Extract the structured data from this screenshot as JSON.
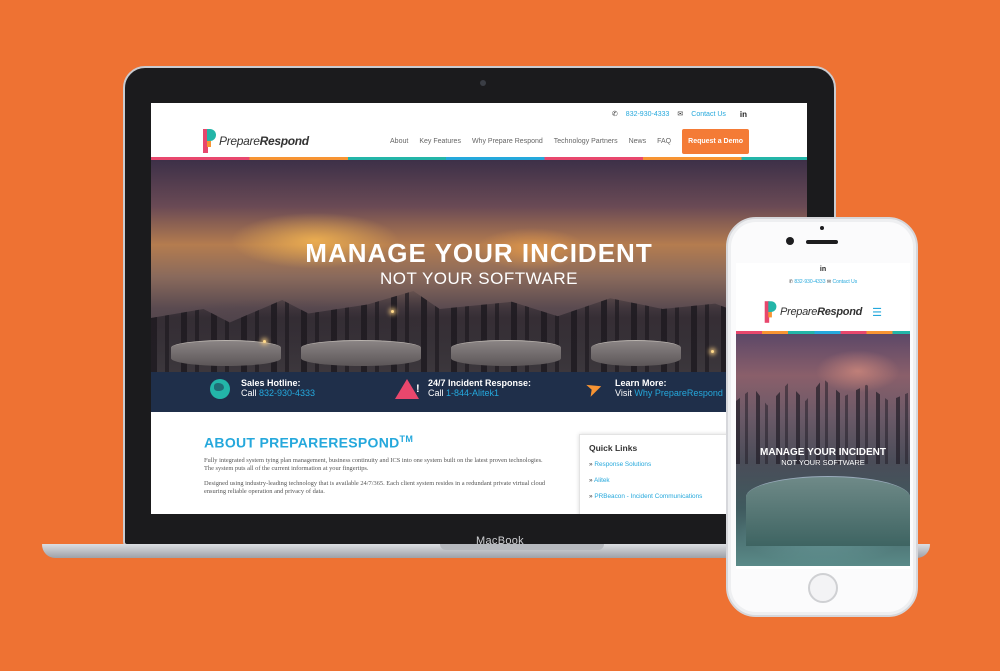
{
  "colors": {
    "background": "#ee7233",
    "brand_blue": "#25a8dc",
    "brand_orange": "#f47b36",
    "brand_pink": "#e8476d",
    "brand_teal": "#23b5a8",
    "band_navy": "#1f2f4a"
  },
  "laptop": {
    "brand_label": "MacBook"
  },
  "site": {
    "top_bar": {
      "phone_icon": "phone-icon",
      "phone": "832-930-4333",
      "mail_icon": "mail-icon",
      "contact": "Contact Us",
      "linkedin": "in"
    },
    "logo": {
      "text_light": "Prepare",
      "text_bold": "Respond"
    },
    "nav": {
      "items": [
        "About",
        "Key Features",
        "Why Prepare Respond",
        "Technology Partners",
        "News",
        "FAQ"
      ],
      "cta": "Request a Demo"
    },
    "hero": {
      "title": "MANAGE YOUR INCIDENT",
      "subtitle": "NOT YOUR SOFTWARE"
    },
    "band": {
      "sales": {
        "icon": "globe-icon",
        "title": "Sales Hotline:",
        "prefix": "Call ",
        "link": "832-930-4333"
      },
      "incident": {
        "icon": "warning-icon",
        "title": "24/7 Incident Response:",
        "prefix": "Call ",
        "link": "1-844-Alitek1"
      },
      "learn": {
        "icon": "location-arrow-icon",
        "title": "Learn More:",
        "prefix": "Visit ",
        "link": "Why PrepareRespond"
      }
    },
    "about": {
      "heading": "ABOUT PREPARERESPOND",
      "heading_sup": "TM",
      "p1": "Fully integrated system tying plan management, business continuity and ICS into one system built on the latest proven technologies. The system puts all of the current information at your fingertips.",
      "p2": "Designed using industry-leading technology that is available 24/7/365. Each client system resides in a redundant private virtual cloud ensuring reliable operation and privacy of data."
    },
    "quick_links": {
      "title": "Quick Links",
      "items": [
        "Response Solutions",
        "Alitek",
        "PRBeacon - Incident Communications"
      ]
    }
  },
  "phone": {
    "linkedin": "in",
    "phone": "832-930-4333",
    "contact": "Contact Us",
    "logo_light": "Prepare",
    "logo_bold": "Respond",
    "menu_icon": "hamburger-menu-icon",
    "hero_title": "MANAGE YOUR INCIDENT",
    "hero_subtitle": "NOT YOUR SOFTWARE"
  }
}
